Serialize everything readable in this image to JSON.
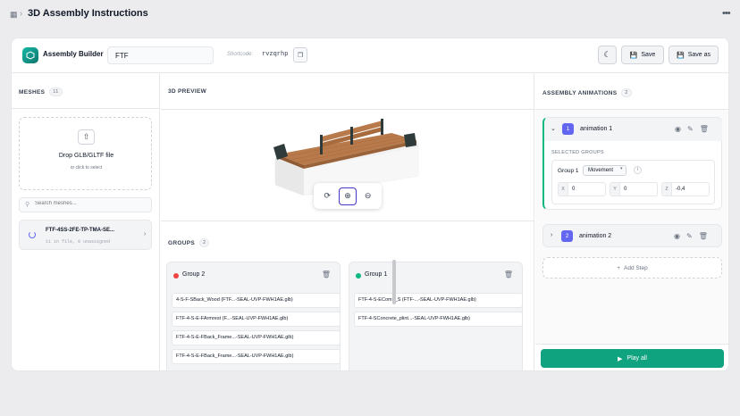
{
  "topbar": {
    "title": "3D Assembly Instructions"
  },
  "header": {
    "app_name": "Assembly Builder",
    "name_value": "FTF",
    "shortcode_label": "Shortcode:",
    "shortcode_value": "rvzqrhp",
    "save_label": "Save",
    "save_as_label": "Save as"
  },
  "meshes": {
    "heading": "MESHES",
    "count": "11",
    "drop_title": "Drop GLB/GLTF file",
    "drop_sub": "or click to select",
    "search_placeholder": "Search meshes...",
    "file_name": "FTF-4SS-2FE-TP-TMA-SE...",
    "file_sub": "11 in file, 0 unassigned"
  },
  "preview": {
    "heading": "3D PREVIEW"
  },
  "groups": {
    "heading": "GROUPS",
    "count": "2",
    "list": [
      {
        "name": "Group 2",
        "color": "#ef4444",
        "files": [
          "4-S-F-SBack_Wood (FTF...-SEAL-UVP-FWH1AE.glb)",
          "FTF-4-S-E-FArmrest (F...-SEAL-UVP-FWH1AE.glb)",
          "FTF-4-S-E-FBack_Frame...-SEAL-UVP-FWH1AE.glb)",
          "FTF-4-S-E-FBack_Frame...-SEAL-UVP-FWH1AE.glb)"
        ]
      },
      {
        "name": "Group 1",
        "color": "#10b981",
        "files": [
          "FTF-4-S-EComb_S (FTF-...-SEAL-UVP-FWH1AE.glb)",
          "FTF-4-SConcrete_plint...-SEAL-UVP-FWH1AE.glb)"
        ]
      }
    ]
  },
  "animations": {
    "heading": "ASSEMBLY ANIMATIONS",
    "count": "2",
    "items": [
      {
        "number": "1",
        "name": "animation 1"
      },
      {
        "number": "2",
        "name": "animation 2"
      }
    ],
    "selected_groups_label": "SELECTED GROUPS",
    "group_name": "Group 1",
    "type_value": "Movement",
    "coords": [
      {
        "axis": "X",
        "value": "0"
      },
      {
        "axis": "Y",
        "value": "0"
      },
      {
        "axis": "Z",
        "value": "-0,4"
      }
    ],
    "add_step_label": "Add Step",
    "play_label": "Play all"
  },
  "colors": {
    "accent": "#10a37f",
    "badge": "#6366f1"
  }
}
